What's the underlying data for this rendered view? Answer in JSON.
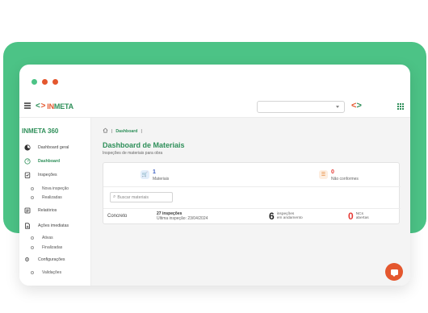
{
  "colors": {
    "brand_green": "#2e8f59",
    "brand_orange": "#e4572e",
    "backdrop_green": "#4cc386",
    "alert_red": "#e53935"
  },
  "window": {
    "dots": [
      "#4cc386",
      "#e4572e",
      "#e4572e"
    ]
  },
  "header": {
    "logo_icon": "logo-chevrons",
    "logo_in": "IN",
    "logo_meta": "META",
    "select_value": "",
    "apps_icon": "grid-icon"
  },
  "sidebar": {
    "title": "INMETA 360",
    "items": [
      {
        "label": "Dashboard geral",
        "icon": "dashboard-icon"
      },
      {
        "label": "Dashboard",
        "icon": "gauge-icon"
      },
      {
        "label": "Inspeções",
        "icon": "clipboard-icon"
      },
      {
        "label": "Nova inspeção"
      },
      {
        "label": "Realizadas"
      },
      {
        "label": "Relatórios",
        "icon": "report-icon"
      },
      {
        "label": "Ações imediatas",
        "icon": "document-icon"
      },
      {
        "label": "Ativas"
      },
      {
        "label": "Finalizadas"
      },
      {
        "label": "Configurações",
        "icon": "gear-icon"
      },
      {
        "label": "Validações"
      }
    ]
  },
  "breadcrumb": {
    "home_icon": "home-icon",
    "current": "Dashboard"
  },
  "page": {
    "title": "Dashboard de Materiais",
    "subtitle": "Inspeções de materiais para obra"
  },
  "stats": [
    {
      "value": "1",
      "label": "Materiais",
      "icon": "cart-icon"
    },
    {
      "value": "0",
      "label": "Não conformes",
      "icon": "list-icon"
    }
  ],
  "search": {
    "placeholder": "Buscar materiais"
  },
  "rows": [
    {
      "name": "Concreto",
      "inspections": "27 inspeções",
      "last": "Última inspeção: 23/04/2024",
      "in_progress_value": "6",
      "in_progress_label_1": "inspeções",
      "in_progress_label_2": "em andamento",
      "nc_value": "0",
      "nc_label_1": "NCs",
      "nc_label_2": "abertas"
    }
  ],
  "chat": {
    "icon": "chat-icon"
  }
}
